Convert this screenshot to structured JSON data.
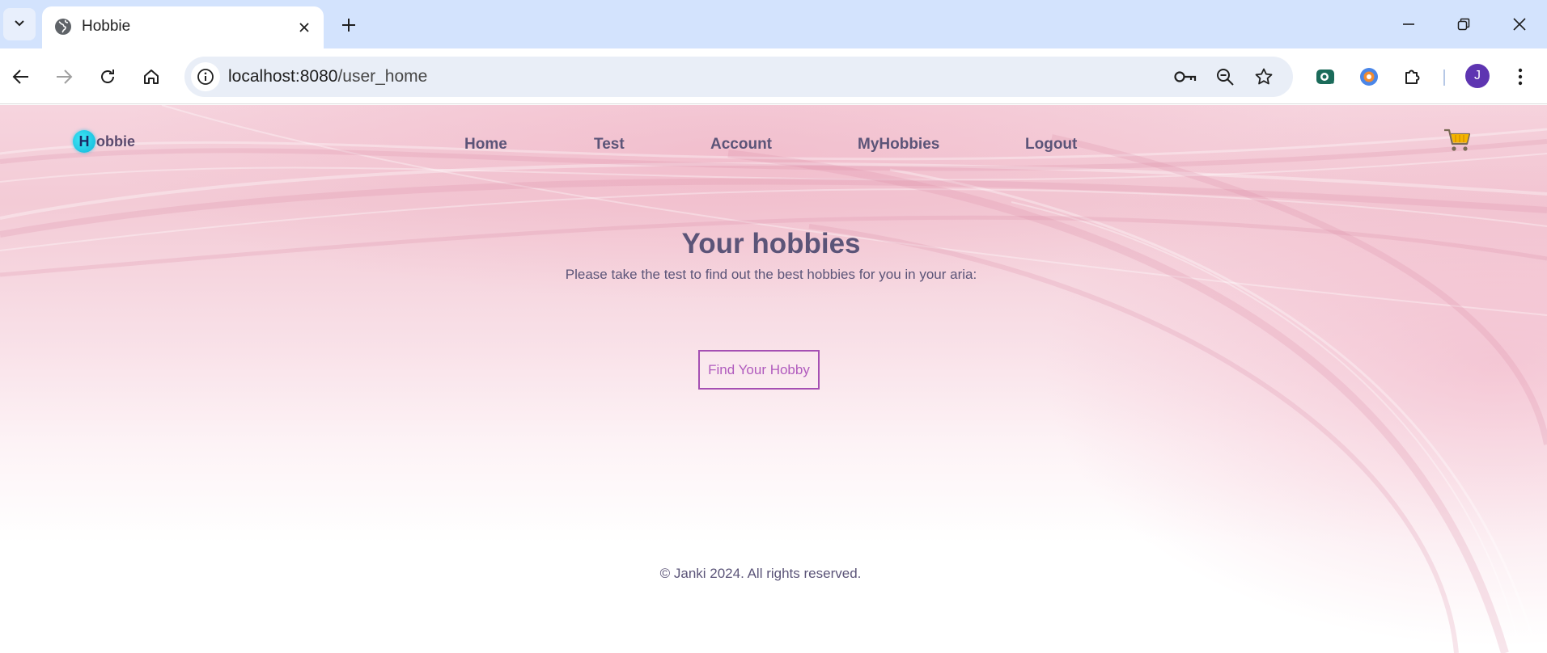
{
  "browser": {
    "tab_title": "Hobbie",
    "url_host": "localhost:8080",
    "url_path": "/user_home",
    "profile_initial": "J",
    "icons": {
      "tab_menu": "chevron-down-icon",
      "tab_favicon": "globe-icon",
      "tab_close": "close-icon",
      "new_tab": "plus-icon",
      "minimize": "minimize-icon",
      "restore": "restore-icon",
      "close_window": "close-icon",
      "back": "arrow-left-icon",
      "forward": "arrow-right-icon",
      "reload": "reload-icon",
      "home": "home-icon",
      "site_info": "info-icon",
      "passwords": "key-icon",
      "zoom": "zoom-icon",
      "bookmark": "star-icon",
      "extensions": "puzzle-icon",
      "menu": "kebab-menu-icon"
    }
  },
  "site": {
    "logo_letter": "H",
    "logo_text": "obbie",
    "nav": [
      {
        "label": "Home"
      },
      {
        "label": "Test"
      },
      {
        "label": "Account"
      },
      {
        "label": "MyHobbies"
      },
      {
        "label": "Logout"
      }
    ],
    "cart_icon": "cart-icon"
  },
  "hero": {
    "title": "Your hobbies",
    "subtitle": "Please take the test to find out the best hobbies for you in your aria:",
    "button_label": "Find Your Hobby"
  },
  "footer": {
    "text": "© Janki 2024. All rights reserved."
  },
  "colors": {
    "text": "#5b5478",
    "button_accent": "#a550b3",
    "tabbar": "#d3e3fd",
    "omnibox": "#e9eef7",
    "avatar": "#5e35b1"
  }
}
